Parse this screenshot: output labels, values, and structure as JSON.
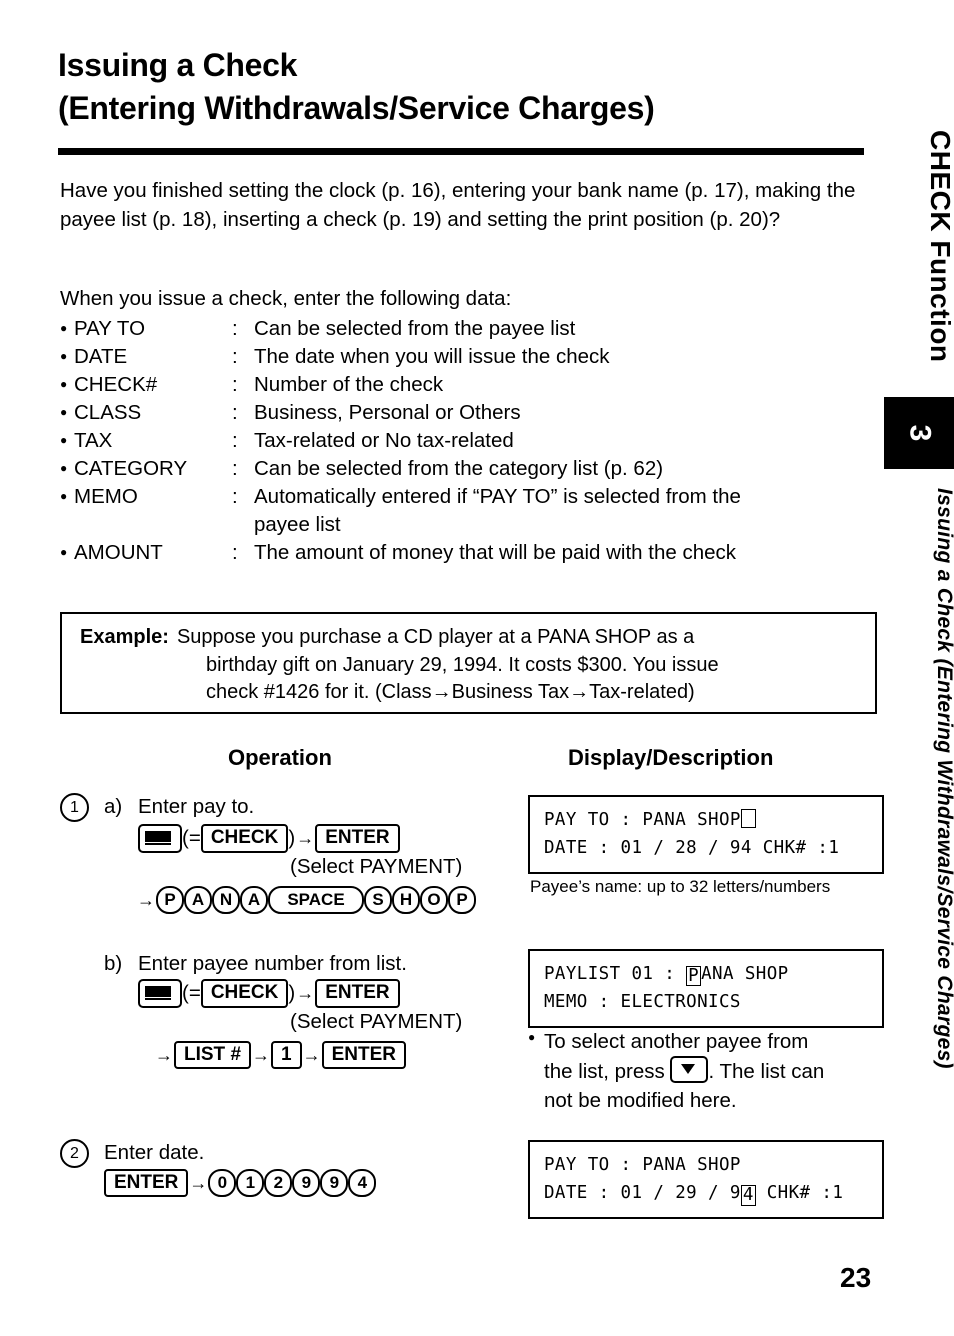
{
  "title": {
    "line1": "Issuing a Check",
    "line2": "(Entering Withdrawals/Service Charges)"
  },
  "intro": "Have you finished setting the clock (p. 16), entering your bank name (p. 17), making the payee list (p. 18), inserting a check (p. 19) and setting the print position (p. 20)?",
  "when_line": "When you issue a check, enter the following data:",
  "data_items": [
    {
      "term": "PAY TO",
      "colon": ":",
      "desc": "Can be selected from the payee list"
    },
    {
      "term": "DATE",
      "colon": ":",
      "desc": "The date when you will issue the check"
    },
    {
      "term": "CHECK#",
      "colon": ":",
      "desc": "Number of the check"
    },
    {
      "term": "CLASS",
      "colon": ":",
      "desc": "Business, Personal or Others"
    },
    {
      "term": "TAX",
      "colon": ":",
      "desc": "Tax-related or No tax-related"
    },
    {
      "term": "CATEGORY",
      "colon": ":",
      "desc": "Can be selected from the category list (p. 62)"
    },
    {
      "term": "MEMO",
      "colon": ":",
      "desc": "Automatically entered if “PAY TO” is selected from the",
      "desc2": "payee list"
    },
    {
      "term": "AMOUNT",
      "colon": ":",
      "desc": "The amount of money that will be paid with the check"
    }
  ],
  "example": {
    "label": "Example:",
    "line1": "Suppose you purchase a CD player at a PANA SHOP as a",
    "line2": "birthday gift on January 29, 1994. It costs $300. You issue",
    "line3": "check #1426 for it. (Class→Business        Tax→Tax-related)"
  },
  "headings": {
    "operation": "Operation",
    "display": "Display/Description"
  },
  "steps": {
    "step1_num": "1",
    "step1a_label": "a)",
    "step1a_text": "Enter pay to.",
    "step1a_eq": "(=",
    "step1a_check": "CHECK",
    "step1a_close": ")",
    "step1a_enter": "ENTER",
    "step1a_select": "(Select PAYMENT)",
    "step1a_keys": [
      "P",
      "A",
      "N",
      "A",
      "SPACE",
      "S",
      "H",
      "O",
      "P"
    ],
    "step1b_label": "b)",
    "step1b_text": "Enter payee number from list.",
    "step1b_eq": "(=",
    "step1b_check": "CHECK",
    "step1b_close": ")",
    "step1b_enter": "ENTER",
    "step1b_select": "(Select PAYMENT)",
    "step1b_list": "LIST #",
    "step1b_one": "1",
    "step1b_enter2": "ENTER",
    "step2_num": "2",
    "step2_text": "Enter date.",
    "step2_enter": "ENTER",
    "step2_keys": [
      "0",
      "1",
      "2",
      "9",
      "9",
      "4"
    ]
  },
  "displays": {
    "d1_line1_pre": "PAY TO : PANA SHOP",
    "d1_line2": "DATE : 01 / 28 / 94 CHK# :1",
    "d1_caption": "Payee’s name:  up to 32 letters/numbers",
    "d2_line1_pre": "PAYLIST 01 : ",
    "d2_line1_cursor": "P",
    "d2_line1_post": "ANA SHOP",
    "d2_line2": "MEMO : ELECTRONICS",
    "d2_note_a": "To select another payee from",
    "d2_note_b": "the list, press ",
    "d2_note_c": ". The list can",
    "d2_note_d": "not be modified here.",
    "d3_line1": "PAY TO : PANA SHOP",
    "d3_line2_pre": "DATE : 01 / 29 / 9",
    "d3_line2_cursor": "4",
    "d3_line2_post": " CHK# :1"
  },
  "side_tab": {
    "chapter_number": "3",
    "chapter_title": "CHECK Function",
    "running_head": "Issuing a Check (Entering Withdrawals/Service Charges)"
  },
  "page_number": "23"
}
